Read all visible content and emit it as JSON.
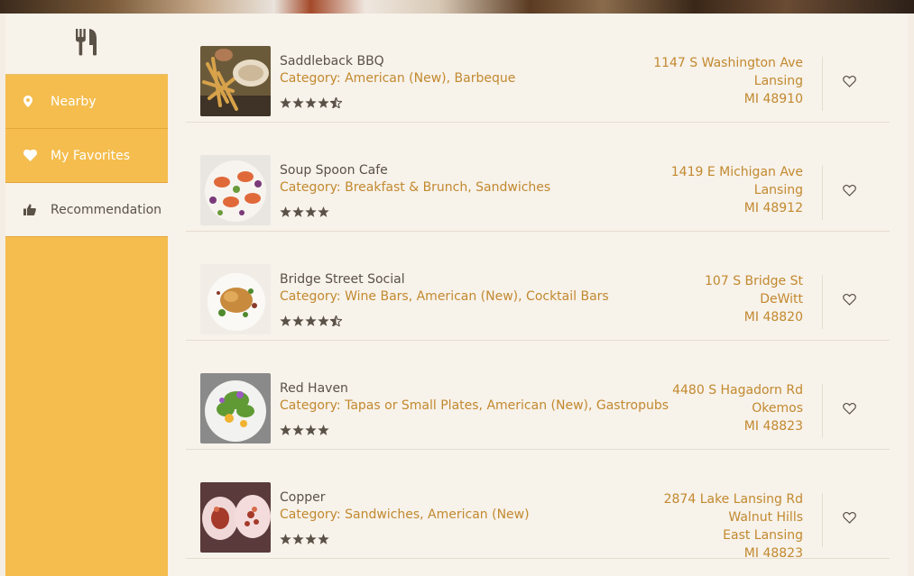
{
  "sidebar": {
    "logo_icon": "utensils-icon",
    "items": [
      {
        "label": "Nearby",
        "icon": "map-marker-icon",
        "active": false
      },
      {
        "label": "My Favorites",
        "icon": "heart-icon",
        "active": false
      },
      {
        "label": "Recommendation",
        "icon": "thumbs-up-icon",
        "active": true
      }
    ]
  },
  "colors": {
    "sidebar_bg": "#f4bd4e",
    "accent_text": "#c2892f",
    "panel_bg": "#f7f2ea",
    "star": "#5a5147"
  },
  "restaurants": [
    {
      "name": "Saddleback BBQ",
      "category_prefix": "Category: ",
      "category": "American (New), Barbeque",
      "rating": 4.5,
      "address": [
        "1147 S Washington Ave",
        "Lansing",
        "MI 48910"
      ]
    },
    {
      "name": "Soup Spoon Cafe",
      "category_prefix": "Category: ",
      "category": "Breakfast & Brunch, Sandwiches",
      "rating": 4,
      "address": [
        "1419 E Michigan Ave",
        "Lansing",
        "MI 48912"
      ]
    },
    {
      "name": "Bridge Street Social",
      "category_prefix": "Category: ",
      "category": "Wine Bars, American (New), Cocktail Bars",
      "rating": 4.5,
      "address": [
        "107 S Bridge St",
        "DeWitt",
        "MI 48820"
      ]
    },
    {
      "name": "Red Haven",
      "category_prefix": "Category: ",
      "category": "Tapas or Small Plates, American (New), Gastropubs",
      "rating": 4,
      "address": [
        "4480 S Hagadorn Rd",
        "Okemos",
        "MI 48823"
      ]
    },
    {
      "name": "Copper",
      "category_prefix": "Category: ",
      "category": "Sandwiches, American (New)",
      "rating": 4,
      "address": [
        "2874 Lake Lansing Rd",
        "Walnut Hills",
        "East Lansing",
        "MI 48823"
      ]
    }
  ]
}
